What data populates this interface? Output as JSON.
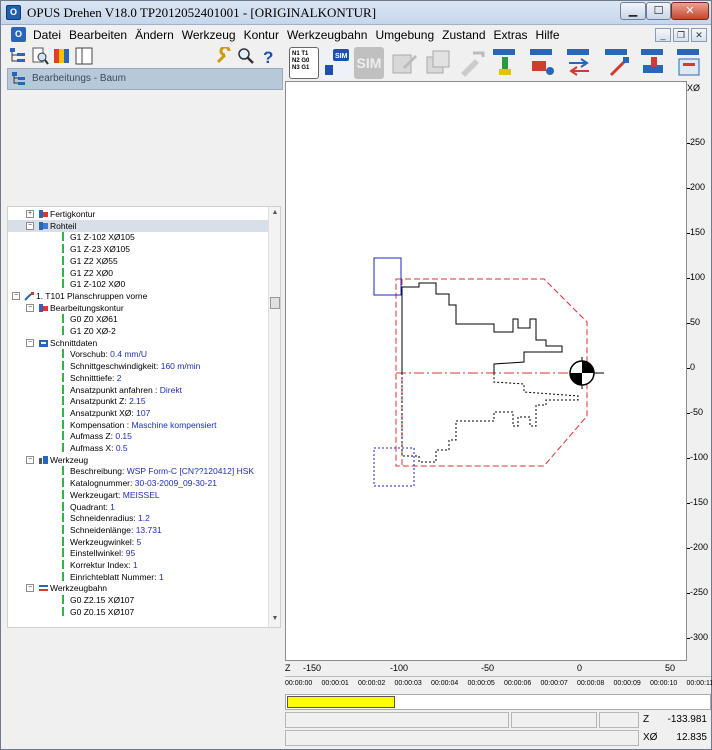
{
  "window": {
    "title": "OPUS Drehen V18.0   TP2012052401001   - [ORIGINALKONTUR]",
    "app_icon": "app-icon"
  },
  "menu": {
    "items": [
      "Datei",
      "Bearbeiten",
      "Ändern",
      "Werkzeug",
      "Kontur",
      "Werkzeugbahn",
      "Umgebung",
      "Zustand",
      "Extras",
      "Hilfe"
    ]
  },
  "right_toolbar": {
    "nc_label": "N1 T1\nN2 G0\nN3 G1",
    "sim1_label": "SIM",
    "sim2_label": "SIM"
  },
  "tree_header": {
    "label": "Bearbeitungs - Baum"
  },
  "tree": [
    {
      "indent": 1,
      "exp": "+",
      "icon": "contour-red-icon",
      "label": "Fertigkontur",
      "value": ""
    },
    {
      "indent": 1,
      "exp": "−",
      "icon": "blank-part-icon",
      "label": "Rohteil",
      "value": "",
      "selected": true
    },
    {
      "indent": 3,
      "leaf": true,
      "label": "G1 Z-102 XØ105",
      "value": ""
    },
    {
      "indent": 3,
      "leaf": true,
      "label": "G1 Z-23 XØ105",
      "value": ""
    },
    {
      "indent": 3,
      "leaf": true,
      "label": "G1 Z2 XØ55",
      "value": ""
    },
    {
      "indent": 3,
      "leaf": true,
      "label": "G1 Z2 XØ0",
      "value": ""
    },
    {
      "indent": 3,
      "leaf": true,
      "label": "G1 Z-102 XØ0",
      "value": ""
    },
    {
      "indent": 0,
      "exp": "−",
      "icon": "tool-op-icon",
      "label": "1. T101 Planschruppen vorne",
      "value": ""
    },
    {
      "indent": 1,
      "exp": "−",
      "icon": "contour-red-icon",
      "label": "Bearbeitungskontur",
      "value": ""
    },
    {
      "indent": 3,
      "leaf": true,
      "label": "G0 Z0 XØ61",
      "value": ""
    },
    {
      "indent": 3,
      "leaf": true,
      "label": "G1 Z0 XØ-2",
      "value": ""
    },
    {
      "indent": 1,
      "exp": "−",
      "icon": "cut-data-icon",
      "label": "Schnittdaten",
      "value": ""
    },
    {
      "indent": 3,
      "leaf": true,
      "label": "Vorschub: ",
      "value": "0.4 mm/U"
    },
    {
      "indent": 3,
      "leaf": true,
      "label": "Schnittgeschwindigkeit: ",
      "value": "160 m/min"
    },
    {
      "indent": 3,
      "leaf": true,
      "label": "Schnitttiefe: ",
      "value": "2"
    },
    {
      "indent": 3,
      "leaf": true,
      "label": "Ansatzpunkt anfahren : ",
      "value": "Direkt"
    },
    {
      "indent": 3,
      "leaf": true,
      "label": "Ansatzpunkt Z: ",
      "value": "2.15"
    },
    {
      "indent": 3,
      "leaf": true,
      "label": "Ansatzpunkt XØ: ",
      "value": "107"
    },
    {
      "indent": 3,
      "leaf": true,
      "label": "Kompensation : ",
      "value": "Maschine kompensiert"
    },
    {
      "indent": 3,
      "leaf": true,
      "label": "Aufmass Z: ",
      "value": "0.15"
    },
    {
      "indent": 3,
      "leaf": true,
      "label": "Aufmass X: ",
      "value": "0.5"
    },
    {
      "indent": 1,
      "exp": "−",
      "icon": "tool-icon",
      "label": "Werkzeug",
      "value": ""
    },
    {
      "indent": 3,
      "leaf": true,
      "label": "Beschreibung: ",
      "value": "WSP Form-C [CN??120412] HSK"
    },
    {
      "indent": 3,
      "leaf": true,
      "label": "Katalognummer: ",
      "value": "30-03-2009_09-30-21"
    },
    {
      "indent": 3,
      "leaf": true,
      "label": "Werkzeugart: ",
      "value": "MEISSEL"
    },
    {
      "indent": 3,
      "leaf": true,
      "label": "Quadrant: ",
      "value": "1"
    },
    {
      "indent": 3,
      "leaf": true,
      "label": "Schneidenradius: ",
      "value": "1.2"
    },
    {
      "indent": 3,
      "leaf": true,
      "label": "Schneidenlänge: ",
      "value": "13.731"
    },
    {
      "indent": 3,
      "leaf": true,
      "label": "Werkzeugwinkel: ",
      "value": "5"
    },
    {
      "indent": 3,
      "leaf": true,
      "label": "Einstellwinkel: ",
      "value": "95"
    },
    {
      "indent": 3,
      "leaf": true,
      "label": "Korrektur Index: ",
      "value": "1"
    },
    {
      "indent": 3,
      "leaf": true,
      "label": "Einrichteblatt Nummer: ",
      "value": "1"
    },
    {
      "indent": 1,
      "exp": "−",
      "icon": "toolpath-icon",
      "label": "Werkzeugbahn",
      "value": ""
    },
    {
      "indent": 3,
      "leaf": true,
      "label": "G0 Z2.15 XØ107",
      "value": ""
    },
    {
      "indent": 3,
      "leaf": true,
      "label": "G0 Z0.15 XØ107",
      "value": ""
    }
  ],
  "cad_view": {
    "x_axis_label": "Z",
    "y_axis_label": "XØ",
    "x_ticks": [
      "-150",
      "-100",
      "-50",
      "0",
      "50"
    ],
    "y_ticks": [
      "250",
      "200",
      "150",
      "100",
      "50",
      "0",
      "-50",
      "-100",
      "-150",
      "-200",
      "-250",
      "-300"
    ]
  },
  "timeline": {
    "ticks": [
      "00:00:00",
      "00:00:01",
      "00:00:02",
      "00:00:03",
      "00:00:04",
      "00:00:05",
      "00:00:06",
      "00:00:07",
      "00:00:08",
      "00:00:09",
      "00:00:10",
      "00:00:11"
    ],
    "progress_fraction": 0.27
  },
  "status": {
    "z_label": "Z",
    "z_value": "-133.981",
    "x_label": "XØ",
    "x_value": "12.835"
  },
  "colors": {
    "accent": "#1f5fae",
    "contour_red": "#e03030",
    "blank_blue": "#2020c0",
    "progress_yellow": "#ffff00",
    "value_blue": "#1d2fb8"
  }
}
